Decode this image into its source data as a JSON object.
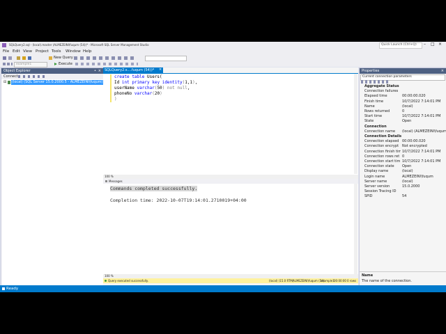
{
  "window": {
    "title": "SQLQuery2.sql - (local).master (ALMEZEINI\\fuqum (54))* - Microsoft SQL Server Management Studio",
    "quick_launch": "Quick Launch (Ctrl+Q)"
  },
  "menu": [
    "File",
    "Edit",
    "View",
    "Project",
    "Tools",
    "Window",
    "Help"
  ],
  "toolbar": {
    "new_query": "New Query",
    "database": "example1",
    "execute": "Execute"
  },
  "object_explorer": {
    "title": "Object Explorer",
    "connect": "Connect",
    "server_node": "(local) (SQL Server 15.0.2000.5 - ALMEZEINI\\fuqum)"
  },
  "editor": {
    "tab_label": "SQLQuery2.s....fuqum (54))*",
    "code_lines": [
      "create table Users(",
      "Id int primary key identity(1,1),",
      "userName varchar(50) not null,",
      "phoneNo varchar(20)",
      ")"
    ],
    "zoom": "100 %",
    "zoom_bottom": "100 %"
  },
  "messages": {
    "tab_label": "Messages",
    "line1": "Commands completed successfully.",
    "line2": "Completion time: 2022-10-07T19:14:01.2710019+04:00"
  },
  "query_status": {
    "text": "Query executed successfully.",
    "server": "(local) (15.0 RTM)",
    "user": "ALMEZEINI\\fuqum (54)",
    "database": "example1",
    "time": "00:00:00",
    "rows": "0 rows"
  },
  "properties": {
    "title": "Properties",
    "selector": "Current connection parameters",
    "rows": [
      {
        "key": "Aggregate Status",
        "value": "",
        "category": true
      },
      {
        "key": "Connection failures",
        "value": ""
      },
      {
        "key": "Elapsed time",
        "value": "00:00:00.020"
      },
      {
        "key": "Finish time",
        "value": "10/7/2022 7:14:01 PM"
      },
      {
        "key": "Name",
        "value": "(local)"
      },
      {
        "key": "Rows returned",
        "value": "0"
      },
      {
        "key": "Start time",
        "value": "10/7/2022 7:14:01 PM"
      },
      {
        "key": "State",
        "value": "Open"
      },
      {
        "key": "Connection",
        "value": "",
        "category": true
      },
      {
        "key": "Connection name",
        "value": "(local) (ALMEZEINI\\fuqum"
      },
      {
        "key": "Connection Details",
        "value": "",
        "category": true
      },
      {
        "key": "Connection elapsed",
        "value": "00:00:00.020"
      },
      {
        "key": "Connection encrypt",
        "value": "Not encrypted"
      },
      {
        "key": "Connection finish tim",
        "value": "10/7/2022 7:14:01 PM"
      },
      {
        "key": "Connection rows ret",
        "value": "0"
      },
      {
        "key": "Connection start tim",
        "value": "10/7/2022 7:14:01 PM"
      },
      {
        "key": "Connection state",
        "value": "Open"
      },
      {
        "key": "Display name",
        "value": "(local)"
      },
      {
        "key": "Login name",
        "value": "ALMEZEINI\\fuqum"
      },
      {
        "key": "Server name",
        "value": "(local)"
      },
      {
        "key": "Server version",
        "value": "15.0.2000"
      },
      {
        "key": "Session Tracing ID",
        "value": ""
      },
      {
        "key": "SPID",
        "value": "54"
      }
    ],
    "desc_title": "Name",
    "desc_text": "The name of the connection."
  },
  "statusbar": {
    "text": "Ready"
  },
  "colors": {
    "accent": "#007acc",
    "pane_header": "#4d6082",
    "highlight": "#3399ff",
    "status_yellow": "#fff29d"
  }
}
